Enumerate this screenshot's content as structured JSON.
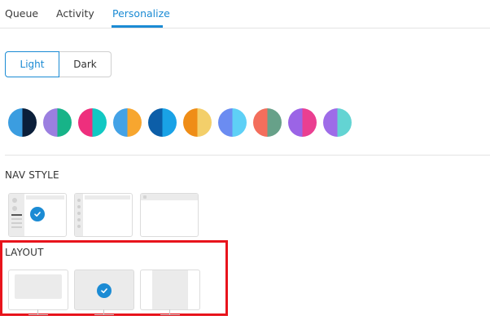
{
  "tabs": [
    {
      "label": "Queue",
      "active": false
    },
    {
      "label": "Activity",
      "active": false
    },
    {
      "label": "Personalize",
      "active": true
    }
  ],
  "theme_mode": {
    "options": [
      "Light",
      "Dark"
    ],
    "selected": "Light"
  },
  "color_themes": [
    {
      "name": "blue-navy",
      "colors": [
        "#3b9de0",
        "#0b1f3a"
      ]
    },
    {
      "name": "purple-green",
      "colors": [
        "#9b7fe0",
        "#17b388"
      ]
    },
    {
      "name": "pink-teal",
      "colors": [
        "#ee2f7d",
        "#11c8c3"
      ]
    },
    {
      "name": "blue-orange",
      "colors": [
        "#43a2e6",
        "#f7a62f"
      ]
    },
    {
      "name": "navy-blue",
      "colors": [
        "#0c5ea8",
        "#19a2e6"
      ]
    },
    {
      "name": "orange-yellow",
      "colors": [
        "#ef8d17",
        "#f3cf6a"
      ]
    },
    {
      "name": "periwinkle-sky",
      "colors": [
        "#6b8cf1",
        "#5ed0f6"
      ]
    },
    {
      "name": "coral-sage",
      "colors": [
        "#f36e5c",
        "#67a189"
      ]
    },
    {
      "name": "purple-magenta",
      "colors": [
        "#9b64e6",
        "#ea3f91"
      ]
    },
    {
      "name": "violet-cyan",
      "colors": [
        "#9e6ce8",
        "#63d4d3"
      ]
    }
  ],
  "nav_style": {
    "label": "NAV STYLE",
    "options": [
      "sidebar-expanded",
      "sidebar-icons",
      "no-sidebar"
    ],
    "selected": "sidebar-expanded"
  },
  "layout": {
    "label": "LAYOUT",
    "options": [
      "contained",
      "full-width",
      "centered-column"
    ],
    "selected": "full-width"
  },
  "colors": {
    "accent": "#1b8bd4",
    "highlight_border": "#e8141c"
  }
}
